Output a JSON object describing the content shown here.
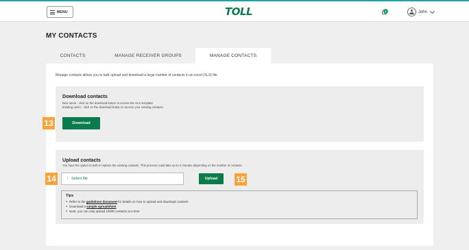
{
  "header": {
    "menu_label": "MENU",
    "logo_text": "TOLL",
    "notification_count": "1",
    "user_name": "John"
  },
  "page": {
    "title": "MY CONTACTS"
  },
  "tabs": [
    {
      "label": "CONTACTS",
      "active": false
    },
    {
      "label": "MANAGE RECEIVER GROUPS",
      "active": false
    },
    {
      "label": "MANAGE CONTACTS",
      "active": true
    }
  ],
  "intro": "Manage contacts allows you to bulk upload and download a large number of contacts in an excel (XLS) file.",
  "download": {
    "title": "Download contacts",
    "line1": "New users - click on the download button to access the XLS template.",
    "line2": "Existing users - click on the download button to access your existing contacts.",
    "button_label": "Download"
  },
  "upload": {
    "title": "Upload contacts",
    "text": "You have the option to add or replace the existing contacts. This process could take up to 2 minutes depending on the number of contacts.",
    "select_label": "Select file",
    "button_label": "Upload",
    "tips": {
      "title": "Tips",
      "item1_pre": "Refer to the ",
      "item1_link": "guidelines document",
      "item1_post": " for details on how to upload and download contacts",
      "item2_pre": "Download a ",
      "item2_link": "sample spreadsheet",
      "item3": "Note, you can only upload 10000 contacts at a time"
    }
  },
  "callouts": {
    "download": "13",
    "select": "14",
    "upload": "15"
  },
  "colors": {
    "brand_green": "#0b7b4b",
    "accent_teal": "#1ea3a8",
    "callout_orange": "#f5a33c"
  }
}
